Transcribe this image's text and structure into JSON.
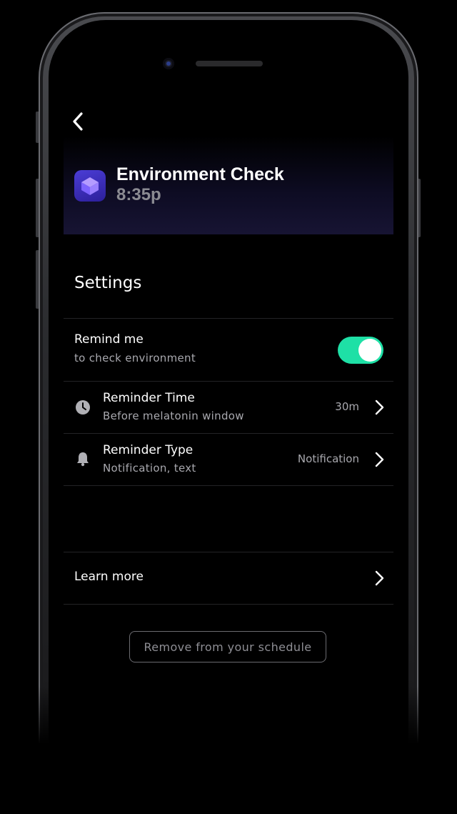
{
  "header": {
    "back_icon": "chevron-left-icon",
    "app_icon": "cube-icon",
    "title": "Environment Check",
    "time": "8:35p"
  },
  "settings": {
    "section_title": "Settings",
    "remind": {
      "label": "Remind me",
      "sub": "to check environment",
      "enabled": true
    },
    "reminder_time": {
      "icon": "clock-icon",
      "label": "Reminder Time",
      "sub": "Before melatonin window",
      "value": "30m"
    },
    "reminder_type": {
      "icon": "bell-icon",
      "label": "Reminder Type",
      "sub": "Notification, text",
      "value": "Notification"
    }
  },
  "learn_more": {
    "label": "Learn more"
  },
  "actions": {
    "remove_label": "Remove from your schedule"
  },
  "colors": {
    "accent_toggle": "#1ee0a6",
    "app_icon_bg": "#4b3dd6",
    "background": "#000000"
  }
}
